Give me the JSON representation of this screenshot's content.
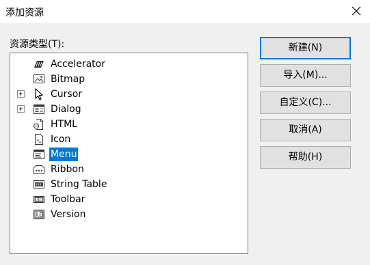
{
  "window": {
    "title": "添加资源"
  },
  "list": {
    "label": "资源类型(T):",
    "items": [
      {
        "label": "Accelerator",
        "icon": "accelerator-icon",
        "expandable": false,
        "selected": false
      },
      {
        "label": "Bitmap",
        "icon": "bitmap-icon",
        "expandable": false,
        "selected": false
      },
      {
        "label": "Cursor",
        "icon": "cursor-icon",
        "expandable": true,
        "selected": false
      },
      {
        "label": "Dialog",
        "icon": "dialog-icon",
        "expandable": true,
        "selected": false
      },
      {
        "label": "HTML",
        "icon": "html-icon",
        "expandable": false,
        "selected": false
      },
      {
        "label": "Icon",
        "icon": "icon-resource-icon",
        "expandable": false,
        "selected": false
      },
      {
        "label": "Menu",
        "icon": "menu-icon",
        "expandable": false,
        "selected": true
      },
      {
        "label": "Ribbon",
        "icon": "ribbon-icon",
        "expandable": false,
        "selected": false
      },
      {
        "label": "String Table",
        "icon": "string-table-icon",
        "expandable": false,
        "selected": false
      },
      {
        "label": "Toolbar",
        "icon": "toolbar-icon",
        "expandable": false,
        "selected": false
      },
      {
        "label": "Version",
        "icon": "version-icon",
        "expandable": false,
        "selected": false
      }
    ]
  },
  "buttons": {
    "new": "新建(N)",
    "import": "导入(M)...",
    "custom": "自定义(C)...",
    "cancel": "取消(A)",
    "help": "帮助(H)"
  },
  "colors": {
    "accent": "#0078d7",
    "button_face": "#e1e1e1",
    "dialog_bg": "#f0f0f0"
  }
}
